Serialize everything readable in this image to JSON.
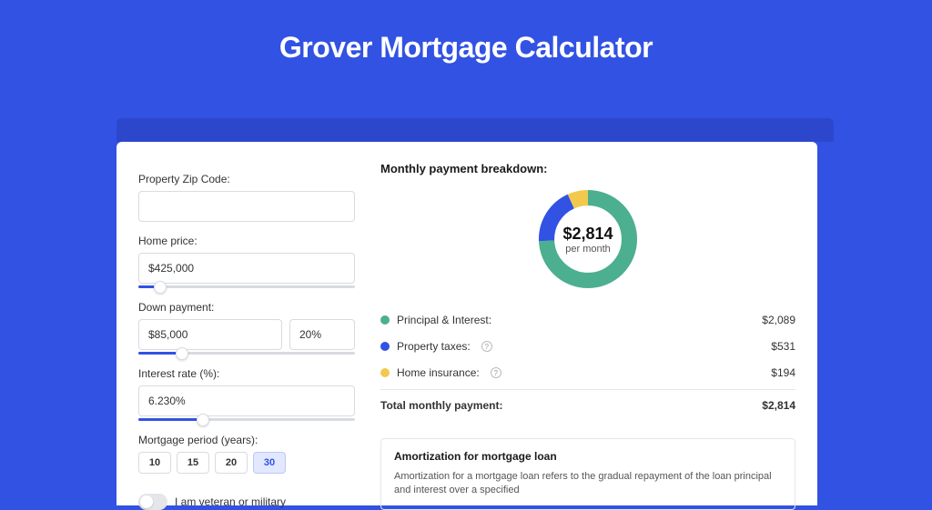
{
  "page": {
    "title": "Grover Mortgage Calculator"
  },
  "form": {
    "zip_label": "Property Zip Code:",
    "zip_value": "",
    "home_price_label": "Home price:",
    "home_price_value": "$425,000",
    "home_price_slider_pct": 10,
    "down_payment_label": "Down payment:",
    "down_payment_value": "$85,000",
    "down_payment_pct": "20%",
    "down_payment_slider_pct": 20,
    "interest_label": "Interest rate (%):",
    "interest_value": "6.230%",
    "interest_slider_pct": 30,
    "period_label": "Mortgage period (years):",
    "periods": [
      "10",
      "15",
      "20",
      "30"
    ],
    "period_active_index": 3,
    "veteran_label": "I am veteran or military"
  },
  "breakdown": {
    "title": "Monthly payment breakdown:",
    "center_value": "$2,814",
    "center_sub": "per month",
    "rows": [
      {
        "label": "Principal & Interest:",
        "value": "$2,089",
        "has_info": false,
        "dot": "green"
      },
      {
        "label": "Property taxes:",
        "value": "$531",
        "has_info": true,
        "dot": "blue"
      },
      {
        "label": "Home insurance:",
        "value": "$194",
        "has_info": true,
        "dot": "yellow"
      }
    ],
    "total_label": "Total monthly payment:",
    "total_value": "$2,814"
  },
  "amort": {
    "title": "Amortization for mortgage loan",
    "text": "Amortization for a mortgage loan refers to the gradual repayment of the loan principal and interest over a specified"
  },
  "chart_data": {
    "type": "pie",
    "title": "Monthly payment breakdown",
    "series": [
      {
        "name": "Principal & Interest",
        "value": 2089,
        "color": "#4caf8f"
      },
      {
        "name": "Property taxes",
        "value": 531,
        "color": "#3252e3"
      },
      {
        "name": "Home insurance",
        "value": 194,
        "color": "#f2c94c"
      }
    ],
    "total": 2814,
    "unit": "USD/month"
  }
}
